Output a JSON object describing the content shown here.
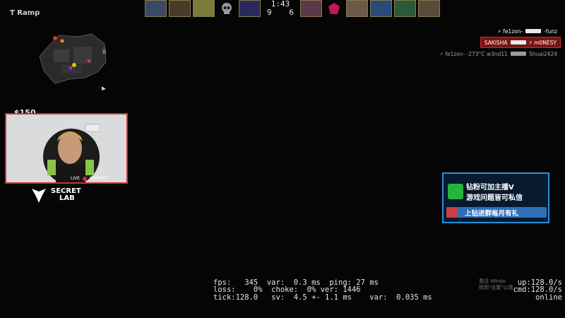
{
  "hud": {
    "location": "T Ramp",
    "money": "$150"
  },
  "scoreboard": {
    "clock": "1:43",
    "score_left": "9",
    "score_right": "6"
  },
  "killfeed": [
    {
      "attacker": "⚡ fe1zon-",
      "victim": "-funz"
    },
    {
      "attacker": "SAKISHA",
      "victim": "⚡ m0NESY"
    },
    {
      "attacker": "⚡ fe1zon- -273°C w3nd11",
      "victim": "Shuai2424"
    }
  ],
  "webcam": {
    "live_label": "LIVE",
    "streamer": "M0NESY"
  },
  "sponsor": {
    "line1": "SECRET",
    "line2": "LAB"
  },
  "promo": {
    "line1": "钻粉可加主播V",
    "line2": "游戏问题皆可私信",
    "line3": "上钻进群每月有礼"
  },
  "netgraph": {
    "row1": "fps:   345  var:  0.3 ms  ping: 27 ms",
    "row2": "loss:    0%  choke:  0% ver: 1446",
    "row3": "tick:128.0   sv:  4.5 +- 1.1 ms    var:  0.035 ms",
    "up": "up:128.0/s",
    "cmd": "cmd:128.0/s",
    "status": "online"
  },
  "watermark": {
    "line1": "激活 Windo",
    "line2": "转到\"设置\"以激"
  }
}
